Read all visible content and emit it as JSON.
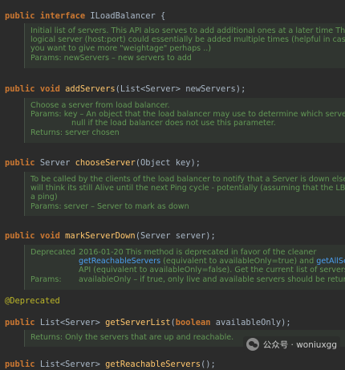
{
  "header": {
    "kw1": "public",
    "kw2": "interface",
    "name": "ILoadBalancer",
    "brace": "{"
  },
  "addServers": {
    "doc": [
      "Initial list of servers. This API also serves to add additional ones at a later time The s",
      "logical server (host:port) could essentially be added multiple times (helpful in cases",
      "you want to give more \"weightage\" perhaps ..)",
      "Params: newServers – new servers to add"
    ],
    "sig": {
      "mod": "public",
      "ret": "void",
      "name": "addServers",
      "params": "(List<Server> newServers);"
    }
  },
  "chooseServer": {
    "doc_desc": "Choose a server from load balancer.",
    "params_label": "Params:",
    "params_text": "key – An object that the load balancer may use to determine which server to",
    "params_cont": "null if the load balancer does not use this parameter.",
    "returns": "Returns: server chosen",
    "sig": {
      "mod": "public",
      "ret": "Server",
      "name": "chooseServer",
      "params": "(Object key);"
    }
  },
  "markServerDown": {
    "doc": [
      "To be called by the clients of the load balancer to notify that a Server is down else, t",
      "will think its still Alive until the next Ping cycle - potentially (assuming that the LB Im",
      "a ping)",
      "Params: server – Server to mark as down"
    ],
    "sig": {
      "mod": "public",
      "ret": "void",
      "name": "markServerDown",
      "params": "(Server server);"
    }
  },
  "getServerList": {
    "deprecated_label": "Deprecated",
    "deprecated_text": "2016-01-20 This method is deprecated in favor of the cleaner",
    "link1": "getReachableServers",
    "mid1": " (equivalent to availableOnly=true) and ",
    "link2": "getAllSe",
    "api_line": "API (equivalent to availableOnly=false). Get the current list of servers.",
    "params_label": "Params:",
    "params_text": "availableOnly – if true, only live and available servers should be returne",
    "annotation": "@Deprecated",
    "sig": {
      "mod": "public",
      "ret": "List<Server>",
      "name": "getServerList",
      "open": "(",
      "ptype": "boolean",
      "pname": " availableOnly);"
    }
  },
  "getReachableServers": {
    "doc": "Returns: Only the servers that are up and reachable.",
    "sig": {
      "mod": "public",
      "ret": "List<Server>",
      "name": "getReachableServers",
      "params": "();"
    }
  },
  "watermark": {
    "account": "公众号 · woniuxgg",
    "icon": "wechat-icon"
  },
  "colors": {
    "background": "#2b2b2b",
    "keyword": "#cc7832",
    "method": "#ffc66d",
    "doc": "#629755",
    "annotation": "#bbb529",
    "link": "#4b9ff0"
  }
}
